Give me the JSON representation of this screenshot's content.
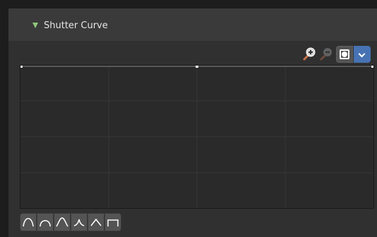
{
  "panel": {
    "title": "Shutter Curve"
  },
  "toolbar": {
    "icons": [
      "zoom-in-icon",
      "zoom-out-icon",
      "clip-icon",
      "chevron-down-icon"
    ]
  },
  "presets": {
    "icons": [
      "smooth-preset-icon",
      "sphere-preset-icon",
      "root-preset-icon",
      "sharp-preset-icon",
      "linear-preset-icon",
      "constant-preset-icon"
    ]
  },
  "colors": {
    "accent": "#4772b3",
    "expand_triangle": "#8ec77d"
  }
}
